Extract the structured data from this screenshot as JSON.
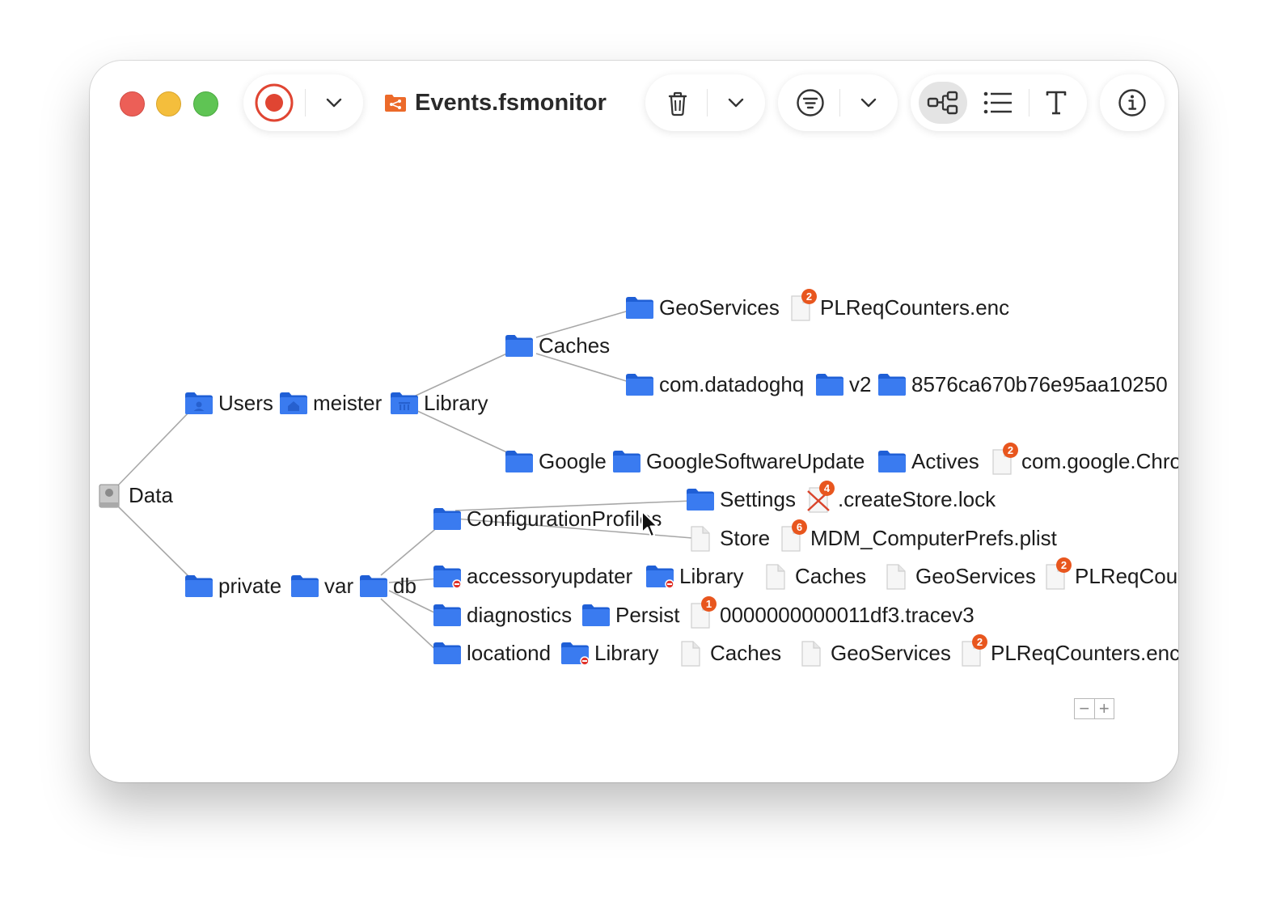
{
  "window": {
    "title": "Events.fsmonitor",
    "icons": {
      "record": "record-icon",
      "trash": "trash-icon",
      "filter": "filter-icon",
      "graph": "graph-view-icon",
      "list": "list-view-icon",
      "text": "text-view-icon",
      "info": "info-icon"
    }
  },
  "colors": {
    "folder": "#3a7bf0",
    "badge": "#e8561e",
    "record": "#e04532",
    "edge": "#a8a8a8"
  },
  "tree": {
    "data": "Data",
    "users": "Users",
    "meister": "meister",
    "library_user": "Library",
    "caches": "Caches",
    "geoservices": "GeoServices",
    "plreq_top": "PLReqCounters.enc",
    "plreq_top_badge": "2",
    "datadog": "com.datadoghq",
    "v2": "v2",
    "hash": "8576ca670b76e95aa10250",
    "google": "Google",
    "gsu": "GoogleSoftwareUpdate",
    "actives": "Actives",
    "chrome": "com.google.Chro",
    "chrome_badge": "2",
    "private": "private",
    "var": "var",
    "db": "db",
    "configprofiles": "ConfigurationProfiles",
    "settings": "Settings",
    "createstore": ".createStore.lock",
    "createstore_badge": "4",
    "store": "Store",
    "mdm": "MDM_ComputerPrefs.plist",
    "mdm_badge": "6",
    "accessory": "accessoryupdater",
    "acc_library": "Library",
    "acc_caches": "Caches",
    "acc_geo": "GeoServices",
    "acc_plreq": "PLReqCour",
    "acc_plreq_badge": "2",
    "diagnostics": "diagnostics",
    "persist": "Persist",
    "tracev3": "0000000000011df3.tracev3",
    "tracev3_badge": "1",
    "locationd": "locationd",
    "loc_library": "Library",
    "loc_caches": "Caches",
    "loc_geo": "GeoServices",
    "loc_plreq": "PLReqCounters.enc",
    "loc_plreq_badge": "2"
  },
  "zoom": {
    "minus": "−",
    "plus": "+"
  }
}
